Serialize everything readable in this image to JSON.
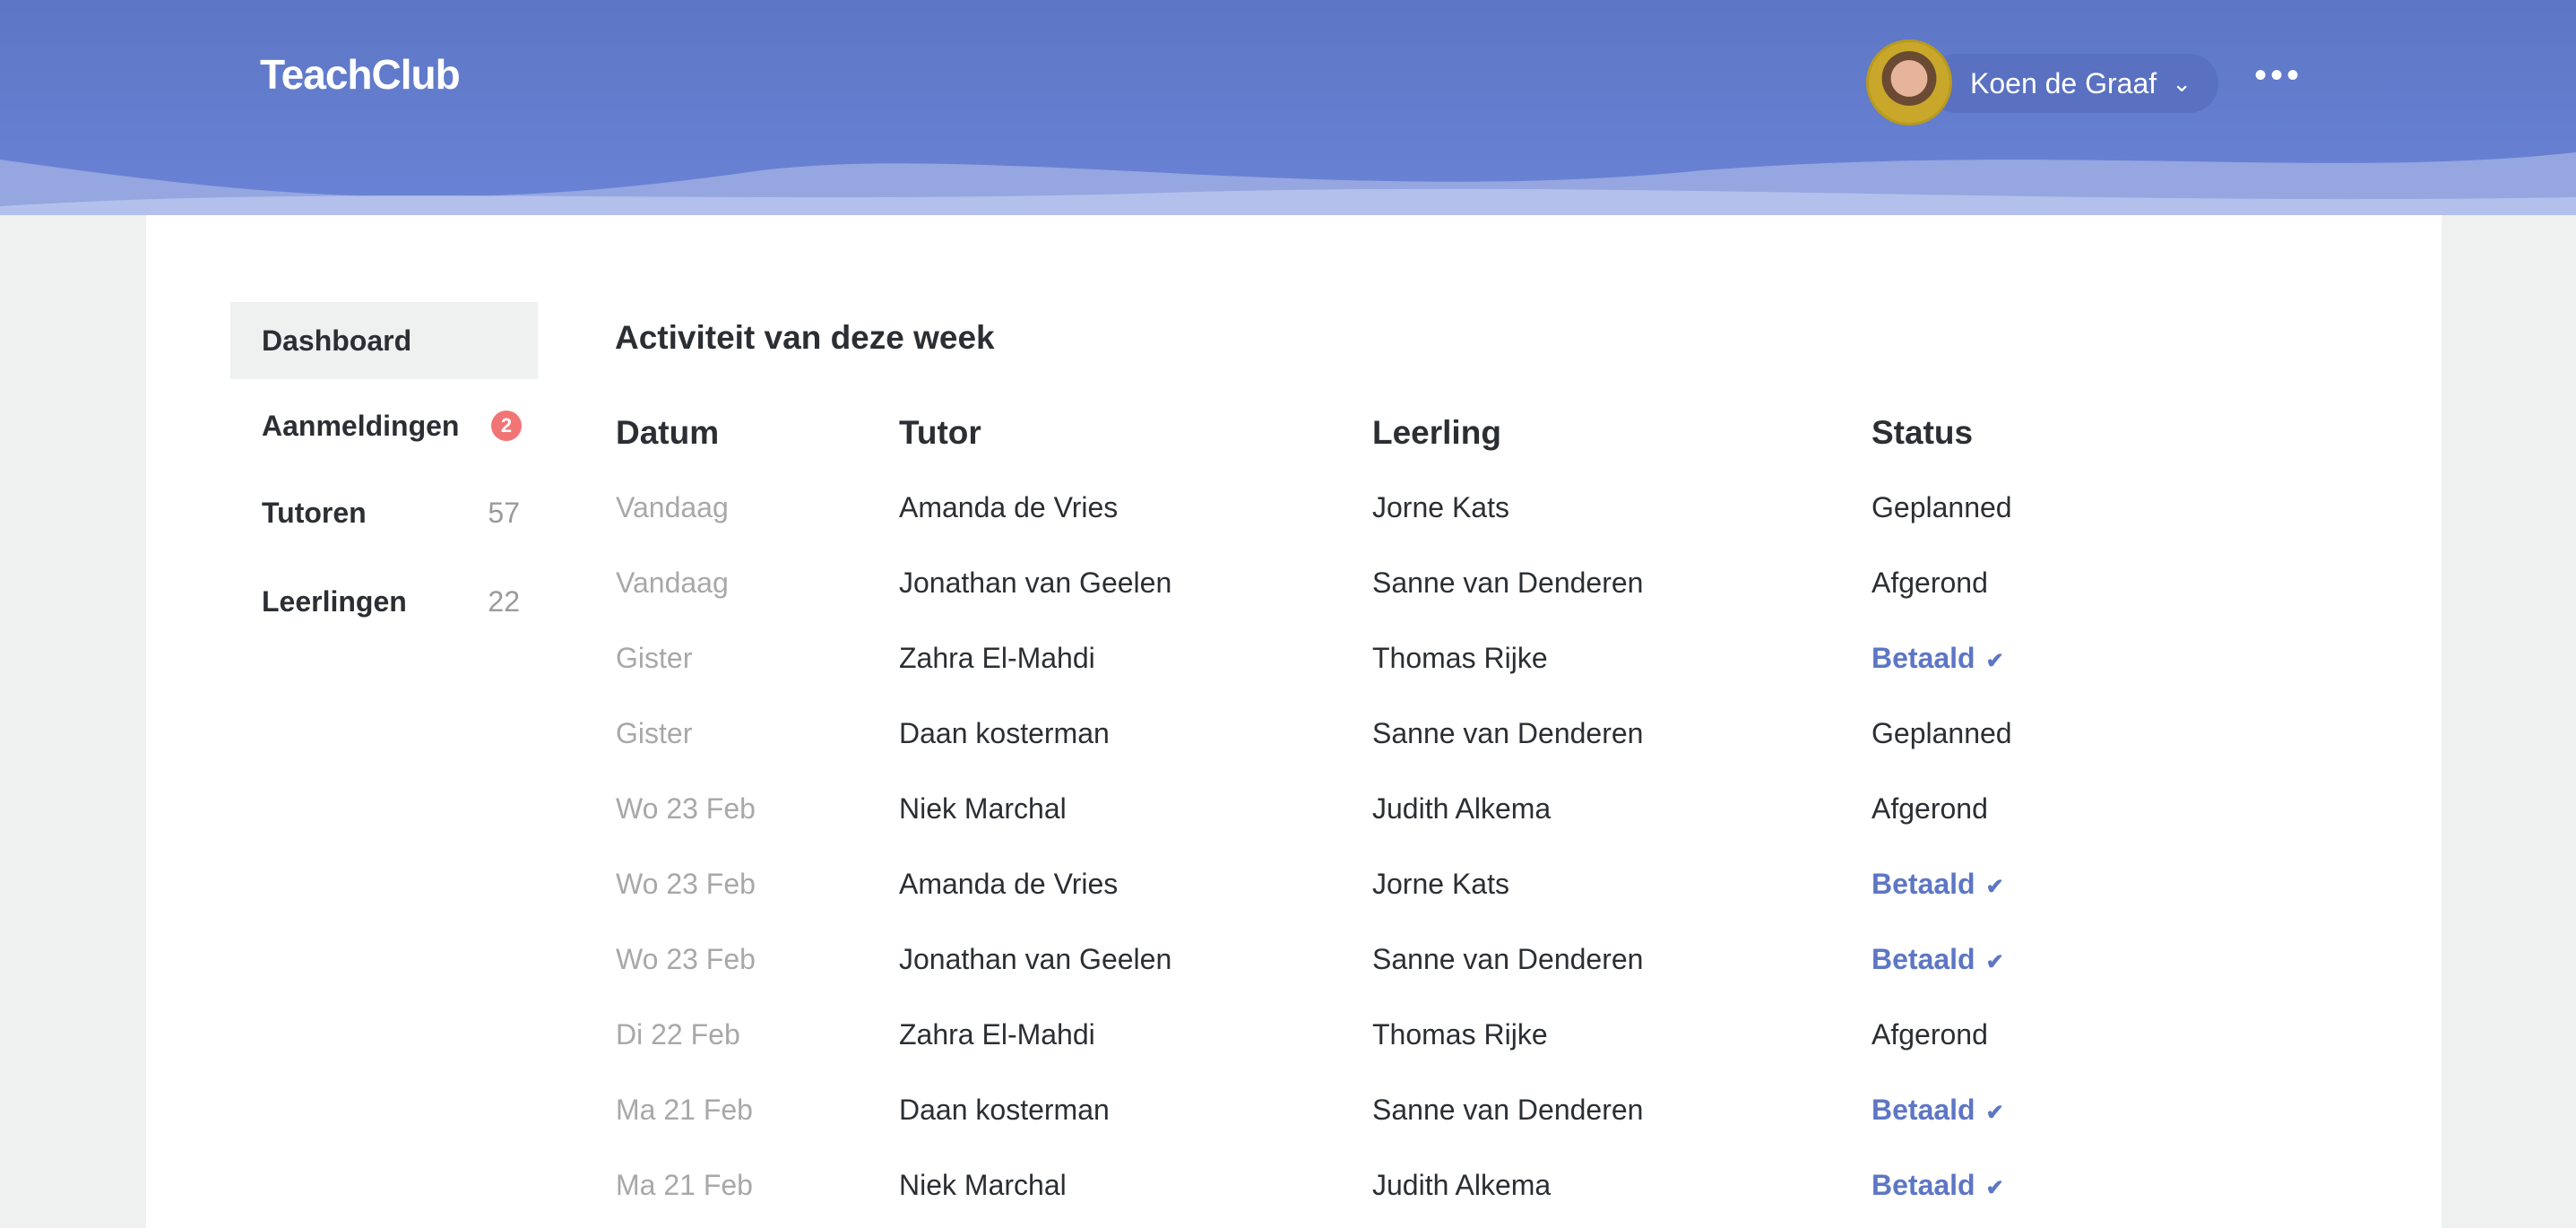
{
  "header": {
    "logo": "TeachClub",
    "user_name": "Koen de Graaf",
    "chevron": "⌄",
    "more": "•••"
  },
  "sidebar": {
    "items": [
      {
        "label": "Dashboard",
        "count": null,
        "active": true
      },
      {
        "label": "Aanmeldingen",
        "badge": "2"
      },
      {
        "label": "Tutoren",
        "count": "57"
      },
      {
        "label": "Leerlingen",
        "count": "22"
      }
    ]
  },
  "main": {
    "title": "Activiteit van deze week",
    "columns": [
      "Datum",
      "Tutor",
      "Leerling",
      "Status"
    ],
    "rows": [
      [
        "Vandaag",
        "Amanda de Vries",
        "Jorne Kats",
        "Geplanned"
      ],
      [
        "Vandaag",
        "Jonathan van Geelen",
        "Sanne van Denderen",
        "Afgerond"
      ],
      [
        "Gister",
        "Zahra El-Mahdi",
        "Thomas Rijke",
        "Betaald"
      ],
      [
        "Gister",
        "Daan kosterman",
        "Sanne van Denderen",
        "Geplanned"
      ],
      [
        "Wo 23 Feb",
        "Niek Marchal",
        "Judith Alkema",
        "Afgerond"
      ],
      [
        "Wo 23 Feb",
        "Amanda de Vries",
        "Jorne Kats",
        "Betaald"
      ],
      [
        "Wo 23 Feb",
        "Jonathan van Geelen",
        "Sanne van Denderen",
        "Betaald"
      ],
      [
        "Di 22 Feb",
        "Zahra El-Mahdi",
        "Thomas Rijke",
        "Afgerond"
      ],
      [
        "Ma 21 Feb",
        "Daan kosterman",
        "Sanne van Denderen",
        "Betaald"
      ],
      [
        "Ma 21 Feb",
        "Niek Marchal",
        "Judith Alkema",
        "Betaald"
      ]
    ]
  },
  "colors": {
    "brand": "#5d76c5",
    "badge": "#f27575"
  }
}
